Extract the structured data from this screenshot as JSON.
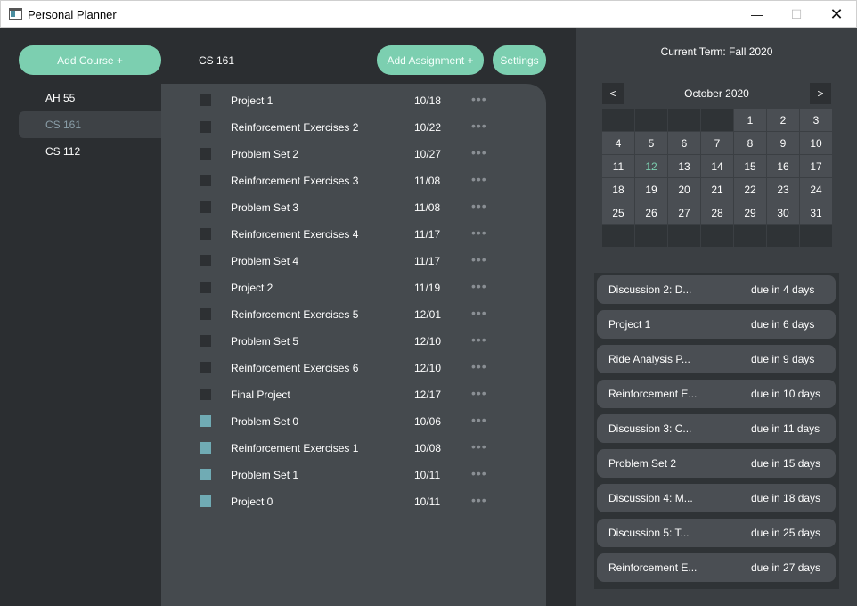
{
  "window": {
    "title": "Personal Planner",
    "min": "—",
    "max": "☐",
    "close": "✕"
  },
  "sidebar": {
    "add_course_label": "Add Course +",
    "courses": [
      {
        "label": "AH 55",
        "active": false
      },
      {
        "label": "CS 161",
        "active": true
      },
      {
        "label": "CS 112",
        "active": false
      }
    ]
  },
  "header": {
    "course_title": "CS 161",
    "add_assignment_label": "Add Assignment +",
    "settings_label": "Settings"
  },
  "assignments": [
    {
      "name": "Project 1",
      "date": "10/18",
      "done": false
    },
    {
      "name": "Reinforcement Exercises 2",
      "date": "10/22",
      "done": false
    },
    {
      "name": "Problem Set 2",
      "date": "10/27",
      "done": false
    },
    {
      "name": "Reinforcement Exercises 3",
      "date": "11/08",
      "done": false
    },
    {
      "name": "Problem Set 3",
      "date": "11/08",
      "done": false
    },
    {
      "name": "Reinforcement Exercises 4",
      "date": "11/17",
      "done": false
    },
    {
      "name": "Problem Set 4",
      "date": "11/17",
      "done": false
    },
    {
      "name": "Project 2",
      "date": "11/19",
      "done": false
    },
    {
      "name": "Reinforcement Exercises 5",
      "date": "12/01",
      "done": false
    },
    {
      "name": "Problem Set 5",
      "date": "12/10",
      "done": false
    },
    {
      "name": "Reinforcement Exercises 6",
      "date": "12/10",
      "done": false
    },
    {
      "name": "Final Project",
      "date": "12/17",
      "done": false
    },
    {
      "name": "Problem Set 0",
      "date": "10/06",
      "done": true
    },
    {
      "name": "Reinforcement Exercises 1",
      "date": "10/08",
      "done": true
    },
    {
      "name": "Problem Set 1",
      "date": "10/11",
      "done": true
    },
    {
      "name": "Project 0",
      "date": "10/11",
      "done": true
    }
  ],
  "more_glyph": "•••",
  "term": "Current Term: Fall 2020",
  "calendar": {
    "month": "October 2020",
    "prev": "<",
    "next": ">",
    "today": "12",
    "cells": [
      "",
      "",
      "",
      "",
      "1",
      "2",
      "3",
      "4",
      "5",
      "6",
      "7",
      "8",
      "9",
      "10",
      "11",
      "12",
      "13",
      "14",
      "15",
      "16",
      "17",
      "18",
      "19",
      "20",
      "21",
      "22",
      "23",
      "24",
      "25",
      "26",
      "27",
      "28",
      "29",
      "30",
      "31",
      "",
      "",
      "",
      "",
      "",
      "",
      ""
    ]
  },
  "due_soon": [
    {
      "name": "Discussion 2: D...",
      "due": "due in 4 days"
    },
    {
      "name": "Project 1",
      "due": "due in 6 days"
    },
    {
      "name": "Ride Analysis P...",
      "due": "due in 9 days"
    },
    {
      "name": "Reinforcement E...",
      "due": "due in 10 days"
    },
    {
      "name": "Discussion 3: C...",
      "due": "due in 11 days"
    },
    {
      "name": "Problem Set 2",
      "due": "due in 15 days"
    },
    {
      "name": "Discussion 4: M...",
      "due": "due in 18 days"
    },
    {
      "name": "Discussion 5: T...",
      "due": "due in 25 days"
    },
    {
      "name": "Reinforcement E...",
      "due": "due in 27 days"
    }
  ],
  "colors": {
    "accent": "#7ccfb0",
    "checked": "#70abb4",
    "panel": "#454a4e",
    "background": "#2b2e31"
  }
}
